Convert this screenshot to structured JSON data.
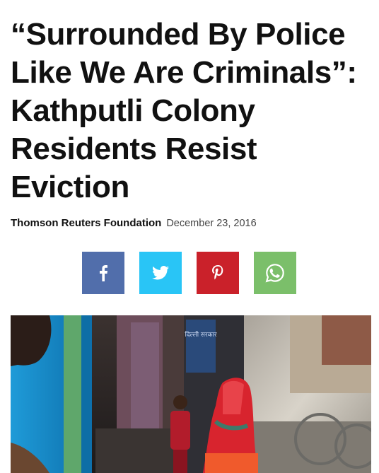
{
  "article": {
    "headline": "“Surrounded By Police Like We Are Criminals”: Kathputli Colony Residents Resist Eviction",
    "author": "Thomson Reuters Foundation",
    "date": "December 23, 2016"
  },
  "share": {
    "buttons": [
      {
        "id": "facebook",
        "icon": "facebook-icon",
        "color": "#516eab"
      },
      {
        "id": "twitter",
        "icon": "twitter-icon",
        "color": "#29c5f6"
      },
      {
        "id": "pinterest",
        "icon": "pinterest-icon",
        "color": "#ca212a"
      },
      {
        "id": "whatsapp",
        "icon": "whatsapp-icon",
        "color": "#7bbf6a"
      }
    ]
  },
  "photo": {
    "sign_text": "दिल्ली सरकार"
  }
}
